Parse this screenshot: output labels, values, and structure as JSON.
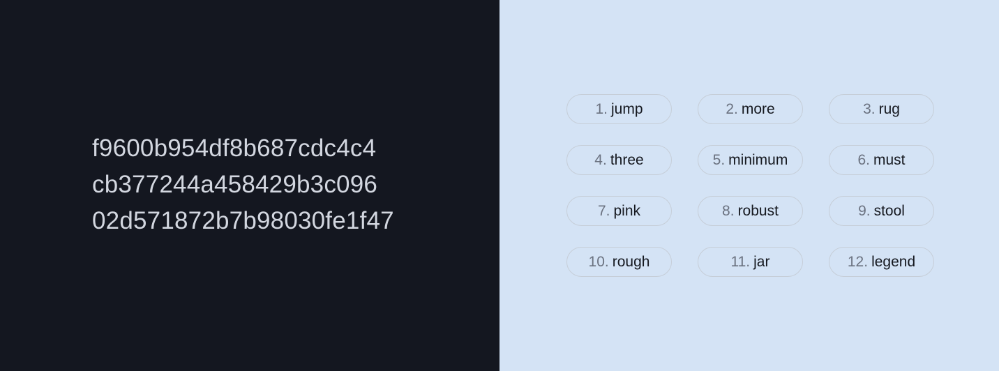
{
  "hash_lines": [
    "f9600b954df8b687cdc4c4",
    "cb377244a458429b3c096",
    "02d571872b7b98030fe1f47"
  ],
  "words": [
    {
      "num": "1.",
      "word": "jump"
    },
    {
      "num": "2.",
      "word": "more"
    },
    {
      "num": "3.",
      "word": "rug"
    },
    {
      "num": "4.",
      "word": "three"
    },
    {
      "num": "5.",
      "word": "minimum"
    },
    {
      "num": "6.",
      "word": "must"
    },
    {
      "num": "7.",
      "word": "pink"
    },
    {
      "num": "8.",
      "word": "robust"
    },
    {
      "num": "9.",
      "word": "stool"
    },
    {
      "num": "10.",
      "word": "rough"
    },
    {
      "num": "11.",
      "word": "jar"
    },
    {
      "num": "12.",
      "word": "legend"
    }
  ],
  "colors": {
    "left_bg": "#141720",
    "right_bg": "#d4e3f5",
    "hash_text": "#d3d7e0",
    "num_text": "#6b7280",
    "word_text": "#15181f"
  }
}
